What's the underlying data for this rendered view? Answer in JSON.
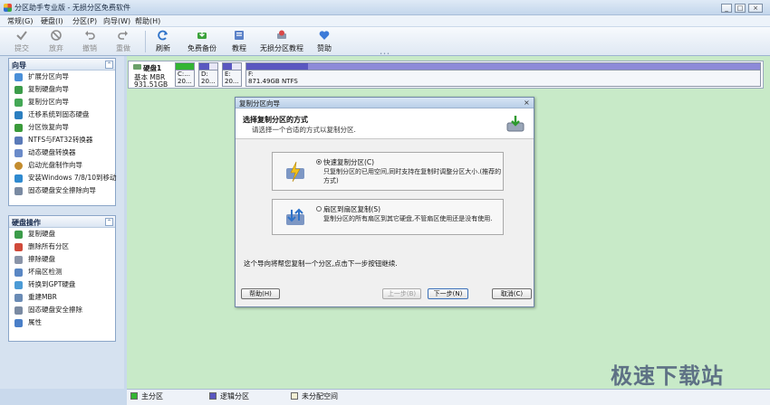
{
  "app": {
    "title": "分区助手专业版 - 无损分区免费软件"
  },
  "window_buttons": [
    "_",
    "□",
    "×"
  ],
  "menu": [
    "常规(G)",
    "硬盘(I)",
    "分区(P)",
    "向导(W)",
    "帮助(H)"
  ],
  "toolbar": {
    "submit": "提交",
    "discard": "放弃",
    "undo": "撤销",
    "redo": "重做",
    "refresh": "刷新",
    "free_backup": "免费备份",
    "tutorial": "教程",
    "lossless_tutorial": "无损分区教程",
    "donate": "赞助"
  },
  "wizard_panel": {
    "title": "向导",
    "items": [
      "扩展分区向导",
      "复制硬盘向导",
      "复制分区向导",
      "迁移系统到固态硬盘",
      "分区恢复向导",
      "NTFS与FAT32转换器",
      "动态硬盘转换器",
      "启动光盘制作向导",
      "安装Windows 7/8/10到移动",
      "固态硬盘安全擦除向导"
    ]
  },
  "disk_panel": {
    "title": "硬盘操作",
    "items": [
      "复制硬盘",
      "删除所有分区",
      "擦除硬盘",
      "坏扇区检测",
      "转换到GPT硬盘",
      "重建MBR",
      "固态硬盘安全擦除",
      "属性"
    ]
  },
  "disk": {
    "name": "硬盘1",
    "type": "基本 MBR",
    "size": "931.51GB",
    "partitions": [
      {
        "letter": "C:...",
        "size": "20...",
        "color": "#33b533"
      },
      {
        "letter": "D:",
        "size": "20...",
        "color": "#5a57c0"
      },
      {
        "letter": "E:",
        "size": "20...",
        "color": "#5a57c0"
      },
      {
        "letter": "F:",
        "size": "871.49GB NTFS",
        "color": "#5a57c0"
      }
    ]
  },
  "dialog": {
    "title": "复制分区向导",
    "close": "×",
    "heading": "选择复制分区的方式",
    "subheading": "请选择一个合适的方式以复制分区.",
    "option1": {
      "title": "快速复制分区(C)",
      "desc": "只复制分区的已用空间,同时支持在复制时调整分区大小.(推荐的方式)"
    },
    "option2": {
      "title": "扇区到扇区复制(S)",
      "desc": "复制分区的所有扇区到其它硬盘,不管扇区使用还是没有使用."
    },
    "footer": "这个导向将帮您复制一个分区,点击下一步按钮继续.",
    "buttons": {
      "help": "帮助(H)",
      "back": "上一步(B)",
      "next": "下一步(N)",
      "cancel": "取消(C)"
    }
  },
  "legend": [
    "主分区",
    "逻辑分区",
    "未分配空间"
  ],
  "colors": {
    "primary": "#33b533",
    "logical": "#5a57c0",
    "unallocated": "#f2efd4"
  },
  "watermark": "极速下载站"
}
